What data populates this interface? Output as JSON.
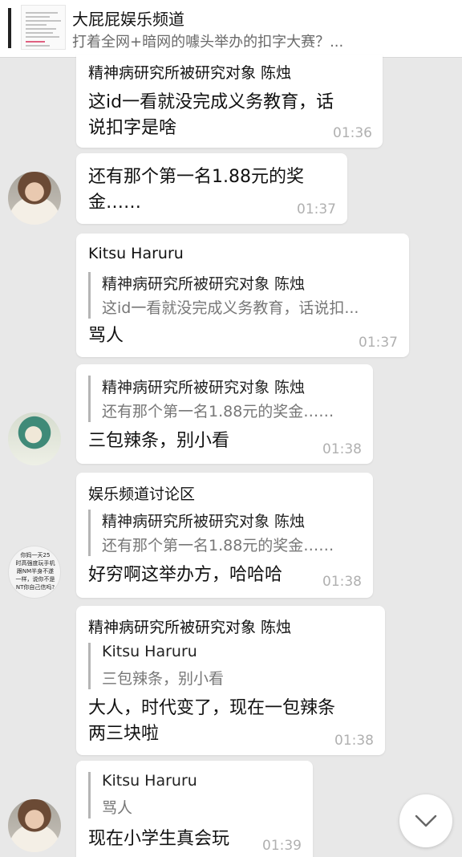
{
  "header": {
    "title": "大屁屁娱乐频道",
    "subtitle": "打着全网+暗网的噱头举办的扣字大赛？..."
  },
  "messages": [
    {
      "sender": "精神病研究所被研究对象 陈烛",
      "lines": [
        "这id一看就没完成义务教育，话",
        "说扣字是啥"
      ],
      "time": "01:36"
    },
    {
      "lines": [
        "还有那个第一名1.88元的奖",
        "金……"
      ],
      "time": "01:37"
    },
    {
      "sender": "Kitsu Haruru",
      "quote": {
        "name": "精神病研究所被研究对象 陈烛",
        "text": "这id一看就没完成义务教育，话说扣..."
      },
      "text": "骂人",
      "time": "01:37"
    },
    {
      "quote": {
        "name": "精神病研究所被研究对象 陈烛",
        "text": "还有那个第一名1.88元的奖金……"
      },
      "text": "三包辣条，别小看",
      "time": "01:38"
    },
    {
      "sender": "娱乐频道讨论区",
      "quote": {
        "name": "精神病研究所被研究对象 陈烛",
        "text": "还有那个第一名1.88元的奖金……"
      },
      "text": "好穷啊这举办方，哈哈哈",
      "time": "01:38",
      "avatar_lines": [
        "你妈一天25",
        "时高强度玩手机",
        "跟NM半身不遂",
        "一样，说你不是",
        "NT你自己信吗?"
      ]
    },
    {
      "sender": "精神病研究所被研究对象 陈烛",
      "quote": {
        "name": "Kitsu Haruru",
        "text": "三包辣条，别小看"
      },
      "lines": [
        "大人，时代变了，现在一包辣条",
        "两三块啦"
      ],
      "time": "01:38"
    },
    {
      "quote": {
        "name": "Kitsu Haruru",
        "text": "骂人"
      },
      "text": "现在小学生真会玩",
      "time": "01:39"
    }
  ],
  "icons": {
    "scroll_down": "chevron-down-icon"
  }
}
